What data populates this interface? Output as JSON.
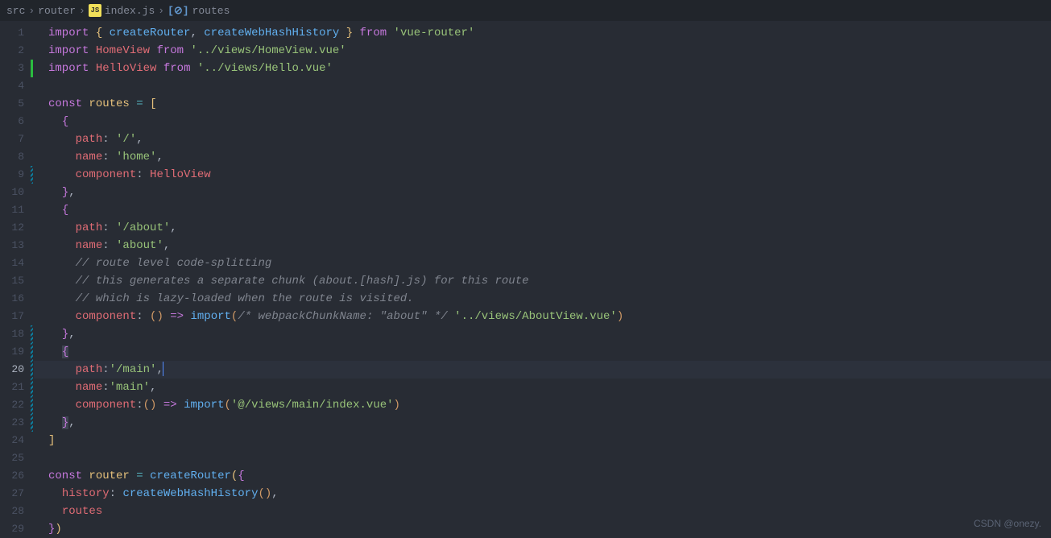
{
  "breadcrumb": {
    "items": [
      "src",
      "router",
      "index.js",
      "routes"
    ],
    "jsIcon": "JS"
  },
  "watermark": "CSDN @onezy.",
  "lines": [
    {
      "n": 1,
      "diff": "",
      "tokens": [
        [
          "kw",
          "import"
        ],
        [
          "punct",
          " "
        ],
        [
          "brace-y",
          "{"
        ],
        [
          "punct",
          " "
        ],
        [
          "fn",
          "createRouter"
        ],
        [
          "punct",
          ", "
        ],
        [
          "fn",
          "createWebHashHistory"
        ],
        [
          "punct",
          " "
        ],
        [
          "brace-y",
          "}"
        ],
        [
          "punct",
          " "
        ],
        [
          "kw",
          "from"
        ],
        [
          "punct",
          " "
        ],
        [
          "str",
          "'vue-router'"
        ]
      ]
    },
    {
      "n": 2,
      "diff": "",
      "tokens": [
        [
          "kw",
          "import"
        ],
        [
          "punct",
          " "
        ],
        [
          "id",
          "HomeView"
        ],
        [
          "punct",
          " "
        ],
        [
          "kw",
          "from"
        ],
        [
          "punct",
          " "
        ],
        [
          "str",
          "'../views/HomeView.vue'"
        ]
      ]
    },
    {
      "n": 3,
      "diff": "added",
      "tokens": [
        [
          "kw",
          "import"
        ],
        [
          "punct",
          " "
        ],
        [
          "id",
          "HelloView"
        ],
        [
          "punct",
          " "
        ],
        [
          "kw",
          "from"
        ],
        [
          "punct",
          " "
        ],
        [
          "str",
          "'../views/Hello.vue'"
        ]
      ]
    },
    {
      "n": 4,
      "diff": "",
      "tokens": []
    },
    {
      "n": 5,
      "diff": "",
      "tokens": [
        [
          "kw",
          "const"
        ],
        [
          "punct",
          " "
        ],
        [
          "var",
          "routes"
        ],
        [
          "punct",
          " "
        ],
        [
          "op",
          "="
        ],
        [
          "punct",
          " "
        ],
        [
          "brace-y",
          "["
        ]
      ]
    },
    {
      "n": 6,
      "diff": "",
      "tokens": [
        [
          "punct",
          "  "
        ],
        [
          "brace-p",
          "{"
        ]
      ]
    },
    {
      "n": 7,
      "diff": "",
      "tokens": [
        [
          "punct",
          "    "
        ],
        [
          "prop",
          "path"
        ],
        [
          "punct",
          ": "
        ],
        [
          "str",
          "'/'"
        ],
        [
          "punct",
          ","
        ]
      ]
    },
    {
      "n": 8,
      "diff": "",
      "tokens": [
        [
          "punct",
          "    "
        ],
        [
          "prop",
          "name"
        ],
        [
          "punct",
          ": "
        ],
        [
          "str",
          "'home'"
        ],
        [
          "punct",
          ","
        ]
      ]
    },
    {
      "n": 9,
      "diff": "modified",
      "tokens": [
        [
          "punct",
          "    "
        ],
        [
          "prop",
          "component"
        ],
        [
          "punct",
          ": "
        ],
        [
          "id",
          "HelloView"
        ]
      ]
    },
    {
      "n": 10,
      "diff": "",
      "tokens": [
        [
          "punct",
          "  "
        ],
        [
          "brace-p",
          "}"
        ],
        [
          "punct",
          ","
        ]
      ]
    },
    {
      "n": 11,
      "diff": "",
      "tokens": [
        [
          "punct",
          "  "
        ],
        [
          "brace-p",
          "{"
        ]
      ]
    },
    {
      "n": 12,
      "diff": "",
      "tokens": [
        [
          "punct",
          "    "
        ],
        [
          "prop",
          "path"
        ],
        [
          "punct",
          ": "
        ],
        [
          "str",
          "'/about'"
        ],
        [
          "punct",
          ","
        ]
      ]
    },
    {
      "n": 13,
      "diff": "",
      "tokens": [
        [
          "punct",
          "    "
        ],
        [
          "prop",
          "name"
        ],
        [
          "punct",
          ": "
        ],
        [
          "str",
          "'about'"
        ],
        [
          "punct",
          ","
        ]
      ]
    },
    {
      "n": 14,
      "diff": "",
      "tokens": [
        [
          "punct",
          "    "
        ],
        [
          "comment",
          "// route level code-splitting"
        ]
      ]
    },
    {
      "n": 15,
      "diff": "",
      "tokens": [
        [
          "punct",
          "    "
        ],
        [
          "comment",
          "// this generates a separate chunk (about.[hash].js) for this route"
        ]
      ]
    },
    {
      "n": 16,
      "diff": "",
      "tokens": [
        [
          "punct",
          "    "
        ],
        [
          "comment",
          "// which is lazy-loaded when the route is visited."
        ]
      ]
    },
    {
      "n": 17,
      "diff": "",
      "tokens": [
        [
          "punct",
          "    "
        ],
        [
          "prop",
          "component"
        ],
        [
          "punct",
          ": "
        ],
        [
          "brace",
          "("
        ],
        [
          "brace",
          ")"
        ],
        [
          "punct",
          " "
        ],
        [
          "kw",
          "=>"
        ],
        [
          "punct",
          " "
        ],
        [
          "fn",
          "import"
        ],
        [
          "brace",
          "("
        ],
        [
          "comment",
          "/* webpackChunkName: \"about\" */"
        ],
        [
          "punct",
          " "
        ],
        [
          "str",
          "'../views/AboutView.vue'"
        ],
        [
          "brace",
          ")"
        ]
      ]
    },
    {
      "n": 18,
      "diff": "modified",
      "tokens": [
        [
          "punct",
          "  "
        ],
        [
          "brace-p",
          "}"
        ],
        [
          "punct",
          ","
        ]
      ]
    },
    {
      "n": 19,
      "diff": "modified",
      "tokens": [
        [
          "punct",
          "  "
        ],
        [
          "sel-open",
          ""
        ],
        [
          "brace-p",
          "{"
        ],
        [
          "sel-close",
          ""
        ]
      ]
    },
    {
      "n": 20,
      "diff": "modified",
      "active": true,
      "highlight": true,
      "tokens": [
        [
          "punct",
          "    "
        ],
        [
          "prop",
          "path"
        ],
        [
          "punct",
          ":"
        ],
        [
          "str",
          "'/main'"
        ],
        [
          "punct",
          ","
        ],
        [
          "cursor",
          ""
        ]
      ]
    },
    {
      "n": 21,
      "diff": "modified",
      "tokens": [
        [
          "punct",
          "    "
        ],
        [
          "prop",
          "name"
        ],
        [
          "punct",
          ":"
        ],
        [
          "str",
          "'main'"
        ],
        [
          "punct",
          ","
        ]
      ]
    },
    {
      "n": 22,
      "diff": "modified",
      "tokens": [
        [
          "punct",
          "    "
        ],
        [
          "prop",
          "component"
        ],
        [
          "punct",
          ":"
        ],
        [
          "brace",
          "("
        ],
        [
          "brace",
          ")"
        ],
        [
          "punct",
          " "
        ],
        [
          "kw",
          "=>"
        ],
        [
          "punct",
          " "
        ],
        [
          "fn",
          "import"
        ],
        [
          "brace",
          "("
        ],
        [
          "str",
          "'@/views/main/index.vue'"
        ],
        [
          "brace",
          ")"
        ]
      ]
    },
    {
      "n": 23,
      "diff": "modified",
      "tokens": [
        [
          "punct",
          "  "
        ],
        [
          "sel-open",
          ""
        ],
        [
          "brace-p",
          "}"
        ],
        [
          "sel-close",
          ""
        ],
        [
          "punct",
          ","
        ]
      ]
    },
    {
      "n": 24,
      "diff": "",
      "tokens": [
        [
          "brace-y",
          "]"
        ]
      ]
    },
    {
      "n": 25,
      "diff": "",
      "tokens": []
    },
    {
      "n": 26,
      "diff": "",
      "tokens": [
        [
          "kw",
          "const"
        ],
        [
          "punct",
          " "
        ],
        [
          "var",
          "router"
        ],
        [
          "punct",
          " "
        ],
        [
          "op",
          "="
        ],
        [
          "punct",
          " "
        ],
        [
          "fn",
          "createRouter"
        ],
        [
          "brace-y",
          "("
        ],
        [
          "brace-p",
          "{"
        ]
      ]
    },
    {
      "n": 27,
      "diff": "",
      "tokens": [
        [
          "punct",
          "  "
        ],
        [
          "prop",
          "history"
        ],
        [
          "punct",
          ": "
        ],
        [
          "fn",
          "createWebHashHistory"
        ],
        [
          "brace",
          "("
        ],
        [
          "brace",
          ")"
        ],
        [
          "punct",
          ","
        ]
      ]
    },
    {
      "n": 28,
      "diff": "",
      "tokens": [
        [
          "punct",
          "  "
        ],
        [
          "id",
          "routes"
        ]
      ]
    },
    {
      "n": 29,
      "diff": "",
      "tokens": [
        [
          "brace-p",
          "}"
        ],
        [
          "brace-y",
          ")"
        ]
      ]
    }
  ]
}
